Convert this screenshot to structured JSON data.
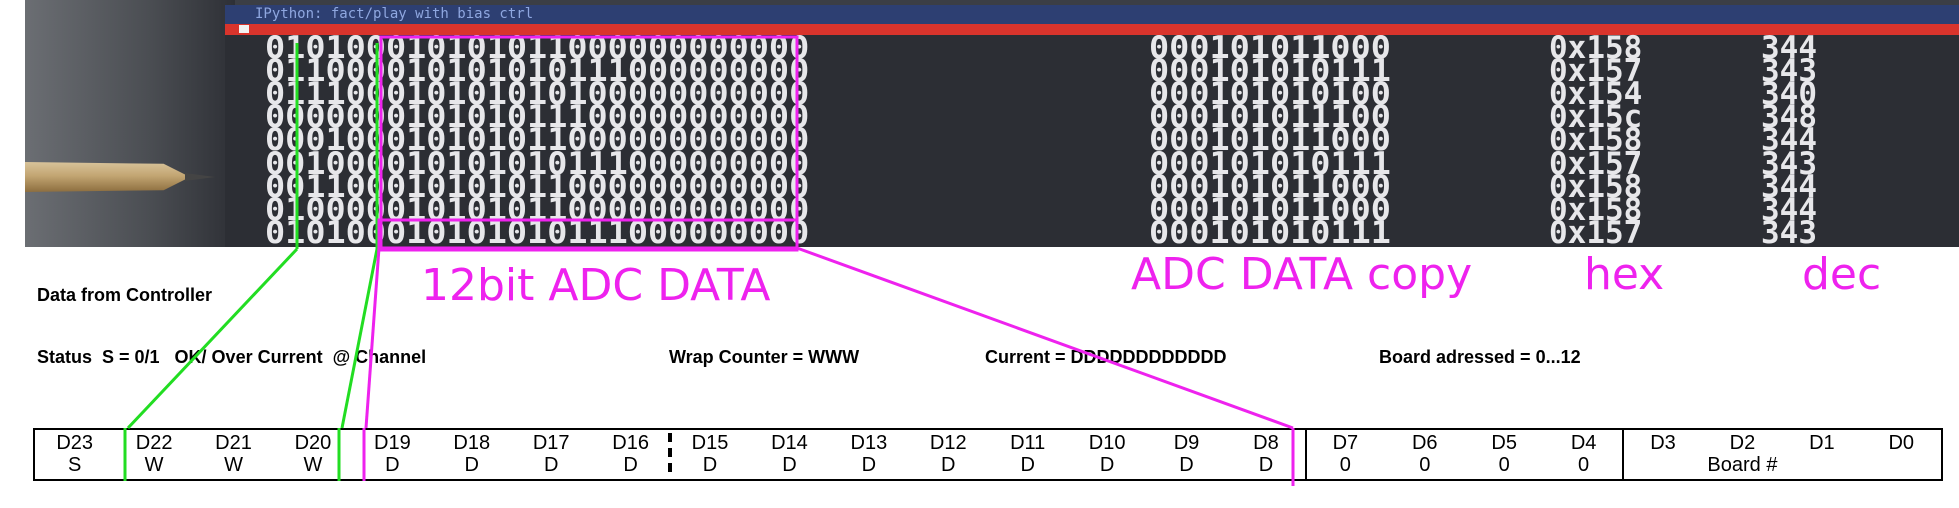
{
  "terminal": {
    "title": "IPython: fact/play with bias ctrl",
    "rows": [
      {
        "binary": "010100010101011000000000000",
        "copy": "000101011000",
        "hex": "0x158",
        "dec": "344"
      },
      {
        "binary": "011000010101010111000000000",
        "copy": "000101010111",
        "hex": "0x157",
        "dec": "343"
      },
      {
        "binary": "011100010101010100000000000",
        "copy": "000101010100",
        "hex": "0x154",
        "dec": "340"
      },
      {
        "binary": "000000010101011100000000000",
        "copy": "000101011100",
        "hex": "0x15c",
        "dec": "348"
      },
      {
        "binary": "000100010101011000000000000",
        "copy": "000101011000",
        "hex": "0x158",
        "dec": "344"
      },
      {
        "binary": "001000010101010111000000000",
        "copy": "000101010111",
        "hex": "0x157",
        "dec": "343"
      },
      {
        "binary": "001100010101011000000000000",
        "copy": "000101011000",
        "hex": "0x158",
        "dec": "344"
      },
      {
        "binary": "010000010101011000000000000",
        "copy": "000101011000",
        "hex": "0x158",
        "dec": "344"
      },
      {
        "binary": "010100010101010111000000000",
        "copy": "000101010111",
        "hex": "0x157",
        "dec": "343"
      }
    ]
  },
  "labels": {
    "adc_data": "12bit ADC DATA",
    "adc_copy": "ADC DATA copy",
    "hex": "hex",
    "dec": "dec"
  },
  "text": {
    "header": "Data from Controller",
    "status": "Status  S = 0/1   OK/ Over Current  @ Channel",
    "wrap": "Wrap Counter = WWW",
    "current": "Current = DDDDDDDDDDDD",
    "board": "Board adressed = 0...12"
  },
  "register": {
    "bits": [
      {
        "name": "D23",
        "value": "S"
      },
      {
        "name": "D22",
        "value": "W"
      },
      {
        "name": "D21",
        "value": "W"
      },
      {
        "name": "D20",
        "value": "W"
      },
      {
        "name": "D19",
        "value": "D"
      },
      {
        "name": "D18",
        "value": "D"
      },
      {
        "name": "D17",
        "value": "D"
      },
      {
        "name": "D16",
        "value": "D"
      },
      {
        "name": "D15",
        "value": "D"
      },
      {
        "name": "D14",
        "value": "D"
      },
      {
        "name": "D13",
        "value": "D"
      },
      {
        "name": "D12",
        "value": "D"
      },
      {
        "name": "D11",
        "value": "D"
      },
      {
        "name": "D10",
        "value": "D"
      },
      {
        "name": "D9",
        "value": "D"
      },
      {
        "name": "D8",
        "value": "D"
      },
      {
        "name": "D7",
        "value": "0"
      },
      {
        "name": "D6",
        "value": "0"
      },
      {
        "name": "D5",
        "value": "0"
      },
      {
        "name": "D4",
        "value": "0"
      },
      {
        "name": "D3",
        "value": ""
      },
      {
        "name": "D2",
        "value": ""
      },
      {
        "name": "D1",
        "value": ""
      },
      {
        "name": "D0",
        "value": ""
      }
    ],
    "board_label": "Board #"
  },
  "colors": {
    "green": "#22dd22",
    "magenta": "#ee22ee",
    "terminal_bg": "#2c2e34",
    "terminal_text": "#e7e7ea",
    "title_bar": "#2d3f72",
    "red_bar": "#d9342c"
  }
}
